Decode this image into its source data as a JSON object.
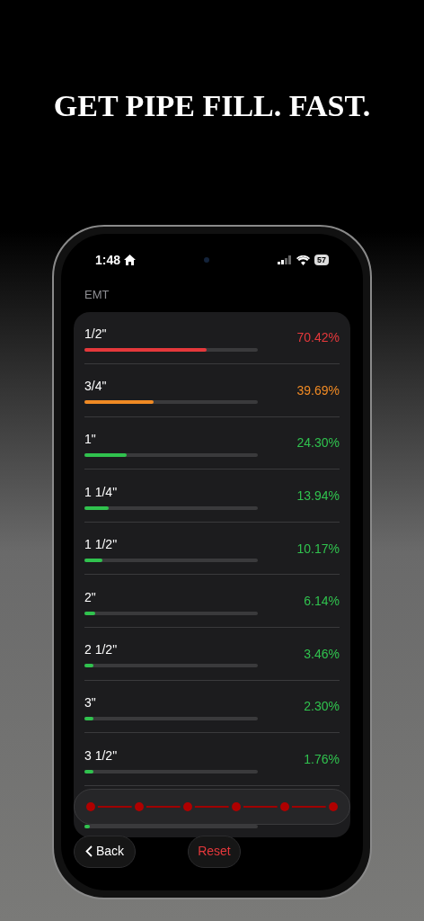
{
  "headline": "GET PIPE FILL. FAST.",
  "status_bar": {
    "time": "1:48",
    "battery": "57"
  },
  "section_title": "EMT",
  "rows": [
    {
      "size": "1/2\"",
      "percent": "70.42%",
      "level": 0.7042,
      "color": "#e5383b"
    },
    {
      "size": "3/4\"",
      "percent": "39.69%",
      "level": 0.3969,
      "color": "#f08a24"
    },
    {
      "size": "1\"",
      "percent": "24.30%",
      "level": 0.243,
      "color": "#30c24e"
    },
    {
      "size": "1 1/4\"",
      "percent": "13.94%",
      "level": 0.1394,
      "color": "#30c24e"
    },
    {
      "size": "1 1/2\"",
      "percent": "10.17%",
      "level": 0.1017,
      "color": "#30c24e"
    },
    {
      "size": "2\"",
      "percent": "6.14%",
      "level": 0.0614,
      "color": "#30c24e"
    },
    {
      "size": "2 1/2\"",
      "percent": "3.46%",
      "level": 0.0346,
      "color": "#30c24e"
    },
    {
      "size": "3\"",
      "percent": "2.30%",
      "level": 0.023,
      "color": "#30c24e"
    },
    {
      "size": "3 1/2\"",
      "percent": "1.76%",
      "level": 0.0176,
      "color": "#30c24e"
    }
  ],
  "hidden_row": {
    "level": 0.0138,
    "color": "#30c24e"
  },
  "buttons": {
    "back": "Back",
    "reset": "Reset"
  }
}
